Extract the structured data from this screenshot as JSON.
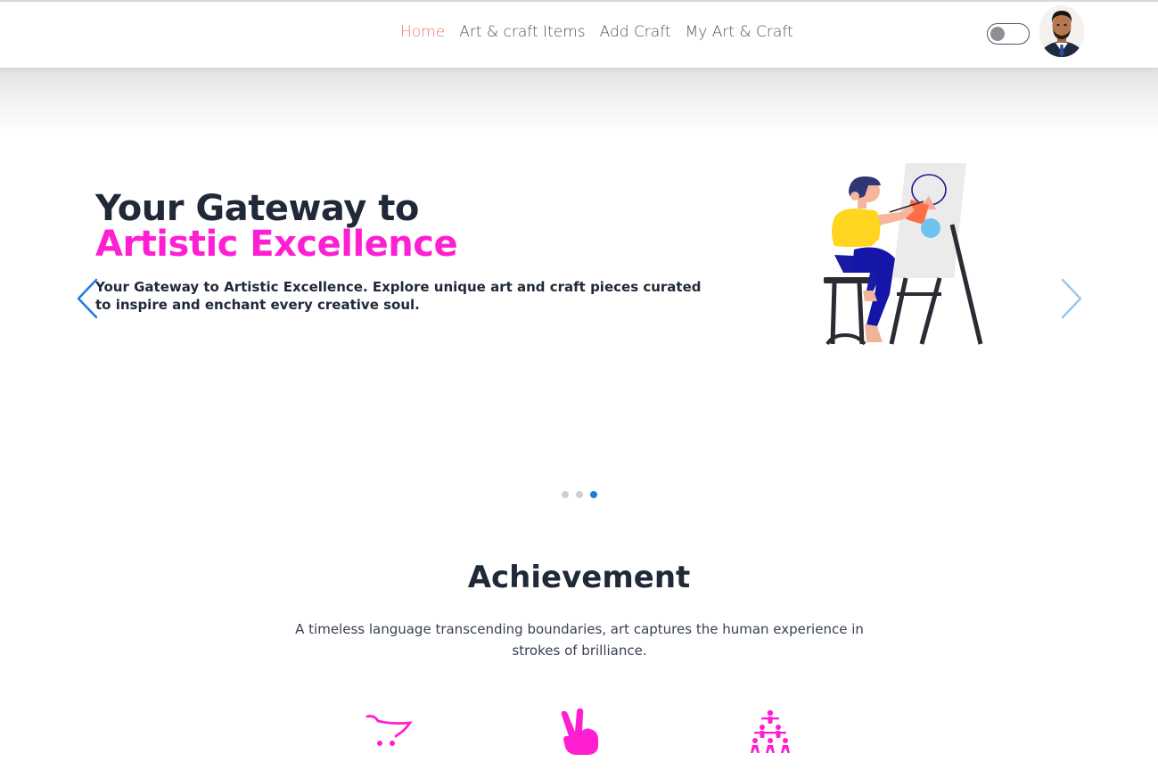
{
  "nav": {
    "links": [
      {
        "label": "Home",
        "active": true
      },
      {
        "label": "Art & craft Items",
        "active": false
      },
      {
        "label": "Add Craft",
        "active": false
      },
      {
        "label": "My Art & Craft",
        "active": false
      }
    ],
    "theme_toggle": {
      "state": "off"
    },
    "avatar": {
      "icon": "user-avatar"
    }
  },
  "hero": {
    "title_line1": "Your Gateway to",
    "title_line2": "Artistic Excellence",
    "description": "Your Gateway to Artistic Excellence. Explore unique art and craft pieces curated to inspire and enchant every creative soul.",
    "prev_icon": "chevron-left-icon",
    "next_icon": "chevron-right-icon",
    "illustration": "painter-at-easel",
    "slides_count": 3,
    "active_slide_index": 2
  },
  "achievement": {
    "title": "Achievement",
    "description": "A timeless language transcending boundaries, art captures the human experience in strokes of brilliance.",
    "icons": [
      "shopping-cart-icon",
      "victory-hand-icon",
      "people-pyramid-icon"
    ]
  },
  "colors": {
    "accent_pink": "#ff1fd3",
    "nav_active": "#f87171",
    "slider_blue": "#1f7ae0",
    "text_dark": "#1f2937"
  }
}
